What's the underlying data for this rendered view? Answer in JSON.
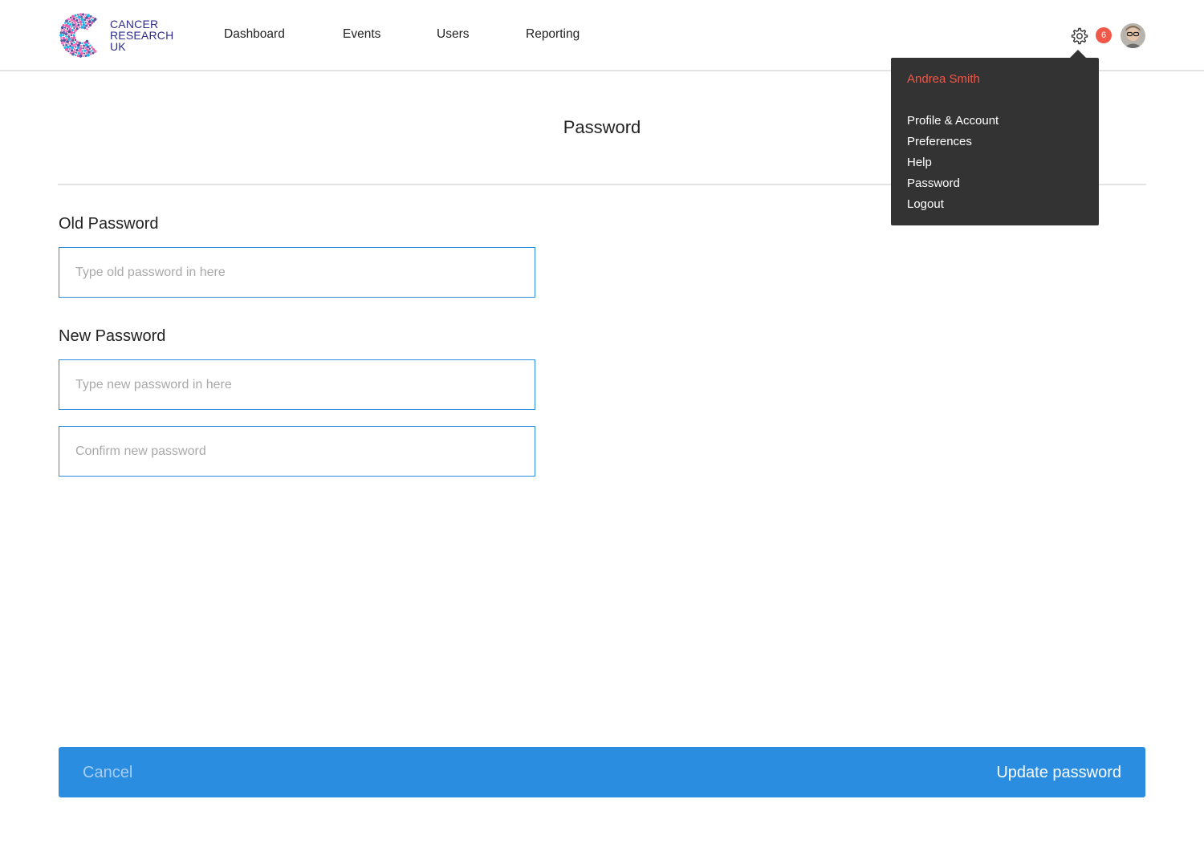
{
  "brand": {
    "name_lines": [
      "CANCER",
      "RESEARCH",
      "UK"
    ],
    "color": "#2e2d8c"
  },
  "nav": {
    "items": [
      {
        "label": "Dashboard"
      },
      {
        "label": "Events"
      },
      {
        "label": "Users"
      },
      {
        "label": "Reporting"
      }
    ]
  },
  "header": {
    "settings_icon": "gear-icon",
    "notification_count": "6",
    "avatar": "user-avatar"
  },
  "user_menu": {
    "user_name": "Andrea Smith",
    "items": [
      {
        "label": "Profile & Account"
      },
      {
        "label": "Preferences"
      },
      {
        "label": "Help"
      },
      {
        "label": "Password"
      },
      {
        "label": "Logout"
      }
    ]
  },
  "page": {
    "title": "Password"
  },
  "form": {
    "old_password": {
      "label": "Old Password",
      "placeholder": "Type old password in here",
      "value": ""
    },
    "new_password": {
      "label": "New Password",
      "placeholder": "Type new password in here",
      "value": ""
    },
    "confirm_password": {
      "placeholder": "Confirm new password",
      "value": ""
    }
  },
  "actions": {
    "cancel_label": "Cancel",
    "update_label": "Update password"
  },
  "colors": {
    "accent": "#2a8de0",
    "badge": "#f0584a",
    "menu_bg": "#333333",
    "user_name": "#f0584a"
  }
}
